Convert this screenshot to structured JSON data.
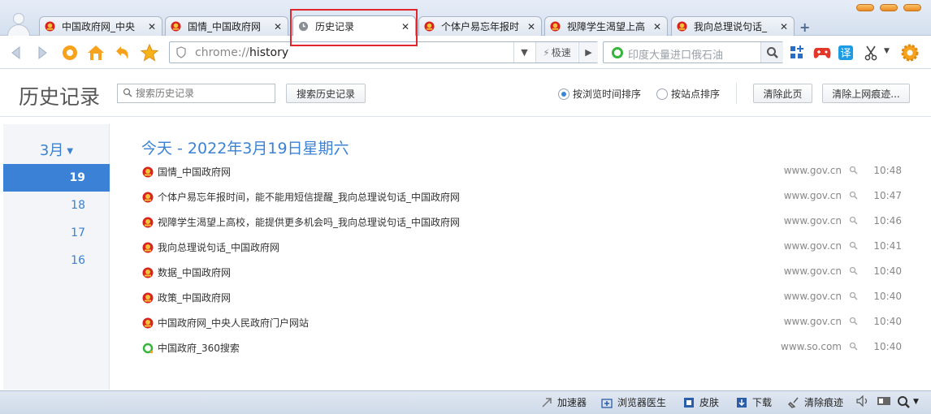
{
  "tabs": [
    {
      "title": "中国政府网_中央",
      "icon": "gov-emblem-icon",
      "active": false
    },
    {
      "title": "国情_中国政府网",
      "icon": "gov-emblem-icon",
      "active": false
    },
    {
      "title": "历史记录",
      "icon": "clock-icon",
      "active": true
    },
    {
      "title": "个体户易忘年报时",
      "icon": "gov-emblem-icon",
      "active": false
    },
    {
      "title": "视障学生渴望上高",
      "icon": "gov-emblem-icon",
      "active": false
    },
    {
      "title": "我向总理说句话_",
      "icon": "gov-emblem-icon",
      "active": false
    }
  ],
  "toolbar": {
    "url_scheme": "chrome://",
    "url_path": "history",
    "mode_label": "极速",
    "search_placeholder": "印度大量进口俄石油"
  },
  "history": {
    "page_title": "历史记录",
    "search_placeholder": "搜索历史记录",
    "search_button": "搜索历史记录",
    "sort_by_time": "按浏览时间排序",
    "sort_by_site": "按站点排序",
    "sort_selected": "time",
    "clear_page": "清除此页",
    "clear_traces": "清除上网痕迹..."
  },
  "sidebar": {
    "month": "3月",
    "days": [
      "19",
      "18",
      "17",
      "16"
    ],
    "active_day": "19"
  },
  "list": {
    "date_heading": "今天 - 2022年3月19日星期六",
    "entries": [
      {
        "title": "国情_中国政府网",
        "domain": "www.gov.cn",
        "time": "10:48",
        "icon": "gov-emblem-icon"
      },
      {
        "title": "个体户易忘年报时间，能不能用短信提醒_我向总理说句话_中国政府网",
        "domain": "www.gov.cn",
        "time": "10:47",
        "icon": "gov-emblem-icon"
      },
      {
        "title": "视障学生渴望上高校，能提供更多机会吗_我向总理说句话_中国政府网",
        "domain": "www.gov.cn",
        "time": "10:46",
        "icon": "gov-emblem-icon"
      },
      {
        "title": "我向总理说句话_中国政府网",
        "domain": "www.gov.cn",
        "time": "10:41",
        "icon": "gov-emblem-icon"
      },
      {
        "title": "数据_中国政府网",
        "domain": "www.gov.cn",
        "time": "10:40",
        "icon": "gov-emblem-icon"
      },
      {
        "title": "政策_中国政府网",
        "domain": "www.gov.cn",
        "time": "10:40",
        "icon": "gov-emblem-icon"
      },
      {
        "title": "中国政府网_中央人民政府门户网站",
        "domain": "www.gov.cn",
        "time": "10:40",
        "icon": "gov-emblem-icon"
      },
      {
        "title": "中国政府_360搜索",
        "domain": "www.so.com",
        "time": "10:40",
        "icon": "so360-icon"
      }
    ]
  },
  "statusbar": {
    "accelerator": "加速器",
    "doctor": "浏览器医生",
    "skin": "皮肤",
    "download": "下载",
    "clear_traces": "清除痕迹"
  },
  "colors": {
    "accent": "#3b82d6",
    "highlight_box": "#e2262b",
    "gov_red": "#d8231e",
    "gov_gold": "#f3c33a",
    "so360_green": "#34b53c"
  }
}
